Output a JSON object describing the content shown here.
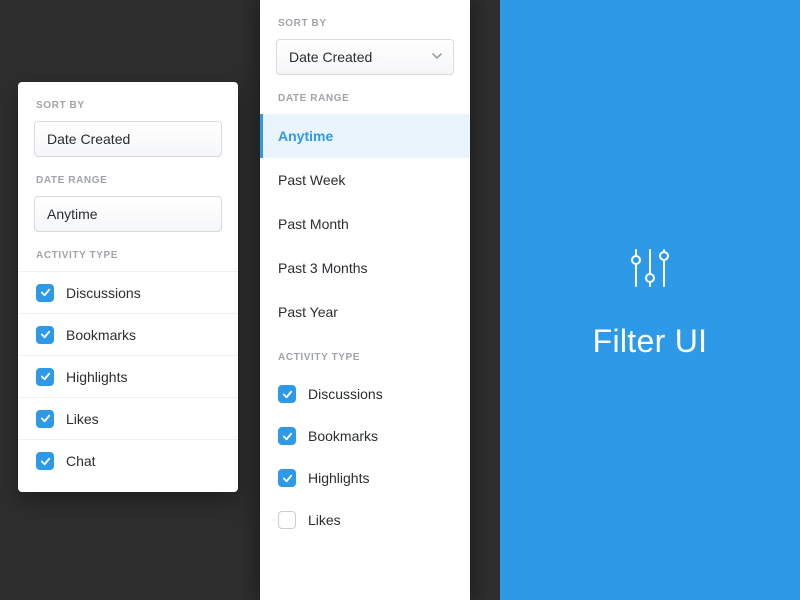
{
  "hero": {
    "title": "Filter UI"
  },
  "labels": {
    "sort_by": "SORT BY",
    "date_range": "DATE RANGE",
    "activity_type": "ACTIVITY TYPE"
  },
  "sort": {
    "selected": "Date Created"
  },
  "back_panel": {
    "date_range_selected": "Anytime",
    "activity": [
      {
        "label": "Discussions",
        "checked": true
      },
      {
        "label": "Bookmarks",
        "checked": true
      },
      {
        "label": "Highlights",
        "checked": true
      },
      {
        "label": "Likes",
        "checked": true
      },
      {
        "label": "Chat",
        "checked": true
      }
    ]
  },
  "front_panel": {
    "date_range_options": [
      {
        "label": "Anytime",
        "selected": true
      },
      {
        "label": "Past Week",
        "selected": false
      },
      {
        "label": "Past Month",
        "selected": false
      },
      {
        "label": "Past 3 Months",
        "selected": false
      },
      {
        "label": "Past Year",
        "selected": false
      }
    ],
    "activity": [
      {
        "label": "Discussions",
        "checked": true
      },
      {
        "label": "Bookmarks",
        "checked": true
      },
      {
        "label": "Highlights",
        "checked": true
      },
      {
        "label": "Likes",
        "checked": false
      }
    ]
  }
}
